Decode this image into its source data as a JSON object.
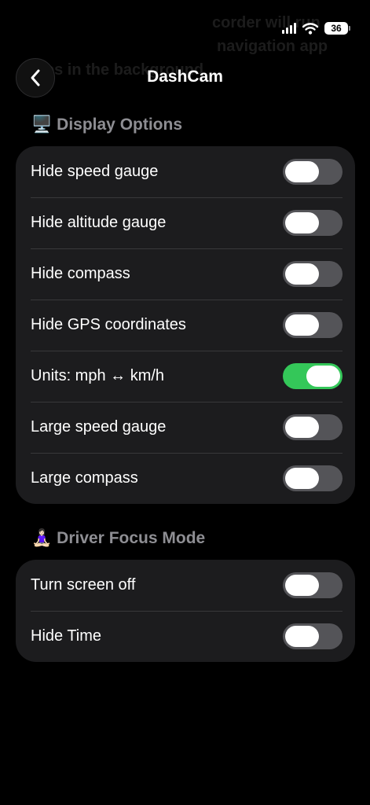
{
  "background_text": [
    "corder will run",
    "navigation app",
    "es in the background"
  ],
  "status_bar": {
    "battery": "36"
  },
  "nav": {
    "title": "DashCam",
    "back_icon": "chevron-left-icon"
  },
  "display_options": {
    "icon": "🖥️",
    "title": "Display Options",
    "items": [
      {
        "label": "Hide speed gauge",
        "on": false
      },
      {
        "label": "Hide altitude gauge",
        "on": false
      },
      {
        "label": "Hide compass",
        "on": false
      },
      {
        "label": "Hide GPS coordinates",
        "on": false
      },
      {
        "label": "Units: mph ↔ km/h",
        "on": true
      },
      {
        "label": "Large speed gauge",
        "on": false
      },
      {
        "label": "Large compass",
        "on": false
      }
    ]
  },
  "driver_focus": {
    "icon": "🧘🏻‍♀️",
    "title": "Driver Focus Mode",
    "items": [
      {
        "label": "Turn screen off",
        "on": false
      },
      {
        "label": "Hide Time",
        "on": false
      }
    ]
  },
  "colors": {
    "background": "#000000",
    "card": "#1c1c1e",
    "toggle_off": "#545458",
    "toggle_on": "#34c759",
    "section_header": "#8e8e93"
  }
}
